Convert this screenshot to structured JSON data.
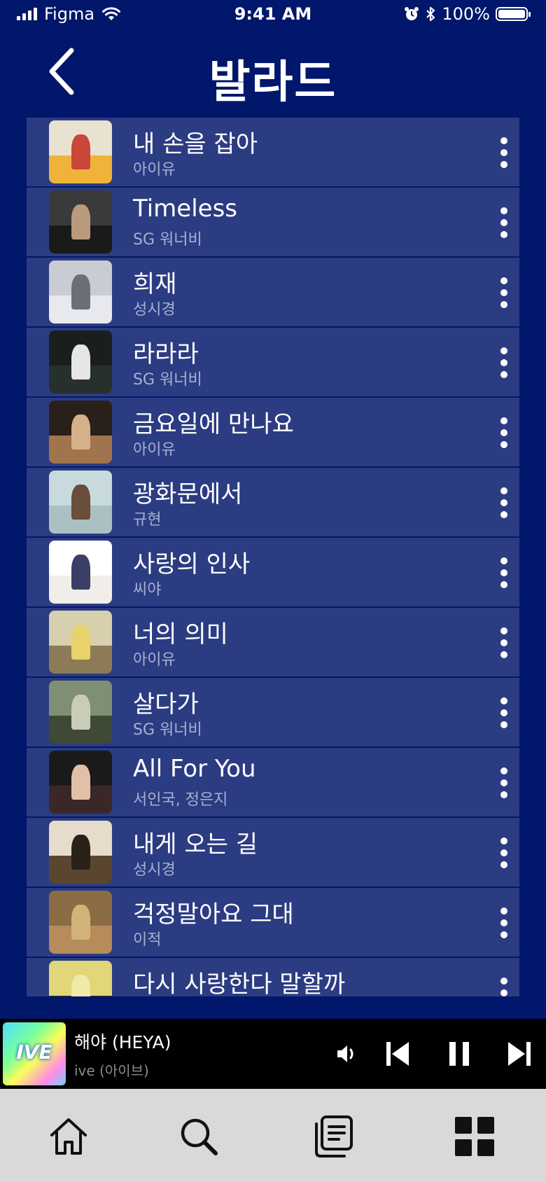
{
  "status_bar": {
    "carrier": "Figma",
    "time": "9:41 AM",
    "battery": "100%"
  },
  "header": {
    "title": "발라드"
  },
  "songs": [
    {
      "title": "내 손을 잡아",
      "artist": "아이유",
      "colors": [
        "#e9e2d0",
        "#f0b33a",
        "#c8463a"
      ]
    },
    {
      "title": "Timeless",
      "artist": "SG 워너비",
      "colors": [
        "#3a3a3a",
        "#1a1a1a",
        "#b99a7d"
      ]
    },
    {
      "title": "희재",
      "artist": "성시경",
      "colors": [
        "#c9ccd3",
        "#e8e9ee",
        "#6b6f78"
      ]
    },
    {
      "title": "라라라",
      "artist": "SG 워너비",
      "colors": [
        "#1a1f1e",
        "#26302c",
        "#e6e6e6"
      ]
    },
    {
      "title": "금요일에 만나요",
      "artist": "아이유",
      "colors": [
        "#2a201a",
        "#a0744c",
        "#d6b08a"
      ]
    },
    {
      "title": "광화문에서",
      "artist": "규현",
      "colors": [
        "#c9dadc",
        "#aac0c2",
        "#6a4d3a"
      ]
    },
    {
      "title": "사랑의 인사",
      "artist": "씨야",
      "colors": [
        "#ffffff",
        "#f1eeea",
        "#3a3f66"
      ]
    },
    {
      "title": "너의 의미",
      "artist": "아이유",
      "colors": [
        "#d8cfae",
        "#8d7a57",
        "#e8d26a"
      ]
    },
    {
      "title": "살다가",
      "artist": "SG 워너비",
      "colors": [
        "#7f8f74",
        "#3f4a36",
        "#c9cdb8"
      ]
    },
    {
      "title": "All For You",
      "artist": "서인국, 정은지",
      "colors": [
        "#1a1a1a",
        "#3a2828",
        "#e2c0a8"
      ]
    },
    {
      "title": "내게 오는 길",
      "artist": "성시경",
      "colors": [
        "#e6dccb",
        "#5a4630",
        "#2a2118"
      ]
    },
    {
      "title": "걱정말아요 그대",
      "artist": "이적",
      "colors": [
        "#8a6c45",
        "#b58c5a",
        "#d2b37a"
      ]
    },
    {
      "title": "다시 사랑한다 말할까",
      "artist": "",
      "colors": [
        "#e1d67a",
        "#3b3418",
        "#f2e9a8"
      ]
    }
  ],
  "now_playing": {
    "title": "해야 (HEYA)",
    "artist": "ive (아이브)",
    "art_text": "IVE"
  },
  "tabs": [
    "home-icon",
    "search-icon",
    "library-icon",
    "grid-icon"
  ]
}
